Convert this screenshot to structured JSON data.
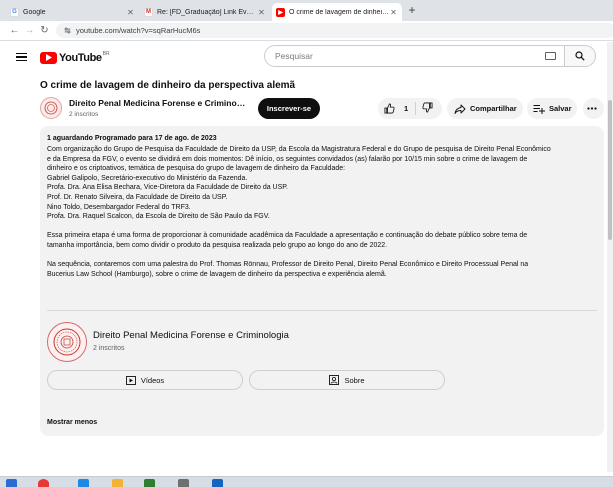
{
  "browser": {
    "tabs": [
      {
        "label": "Google",
        "active": false
      },
      {
        "label": "Re: [FD_Graduação] Link Evento d",
        "active": false
      },
      {
        "label": "O crime de lavagem de dinheiro d",
        "active": true
      }
    ],
    "url": "youtube.com/watch?v=sqRarHucM6s"
  },
  "youtube": {
    "logo_text": "YouTube",
    "region": "BR",
    "search_placeholder": "Pesquisar"
  },
  "video": {
    "title": "O crime de lavagem de dinheiro da perspectiva alemã",
    "channel_name": "Direito Penal Medicina Forense e Criminologia",
    "subscribers": "2 inscritos",
    "subscribe_label": "Inscrever-se",
    "likes": "1",
    "share_label": "Compartilhar",
    "save_label": "Salvar"
  },
  "description": {
    "info_line": "1 aguardando  Programado para 17 de ago. de 2023",
    "lines": [
      "Com organização do Grupo de Pesquisa da Faculdade de Direito da USP, da Escola da Magistratura Federal e do Grupo de pesquisa de Direito Penal Econômico",
      "e da Empresa da FGV, o evento se dividirá em dois momentos: Dê início, os seguintes convidados (as) falarão por 10/15 min sobre o crime de lavagem de",
      "dinheiro e os criptoativos, temática de pesquisa do grupo de lavagem de dinheiro da Faculdade:",
      "Gabriel Galipolo, Secretário-executivo do Ministério da Fazenda.",
      "Profa. Dra. Ana Elisa Bechara, Vice-Diretora da Faculdade de Direito da USP.",
      "Prof. Dr. Renato Silveira, da Faculdade de Direito da USP.",
      "Nino Toldo, Desembargador Federal do TRF3.",
      "Profa. Dra. Raquel Scalcon, da Escola de Direito de São Paulo da FGV.",
      "",
      "Essa primeira etapa é uma forma de proporcionar à comunidade acadêmica da Faculdade a apresentação e continuação do debate público sobre tema de",
      "tamanha importância, bem como dividir o produto da pesquisa realizada pelo grupo ao longo do ano de 2022.",
      "",
      "Na sequência, contaremos com uma palestra do Prof. Thomas Rönnau, Professor de Direito Penal, Direito Penal Econômico e Direito Processual Penal na",
      "Bucerius Law School (Hamburgo), sobre o crime de lavagem de dinheiro da perspectiva e experiência alemã."
    ],
    "channel_card": {
      "name": "Direito Penal Medicina Forense e Criminologia",
      "subscribers": "2 inscritos",
      "videos_label": "Vídeos",
      "about_label": "Sobre"
    },
    "show_less": "Mostrar menos"
  },
  "colors": {
    "accent_red": "#ff0000",
    "surface": "#f2f2f2",
    "taskbar": "#d7dde4"
  }
}
